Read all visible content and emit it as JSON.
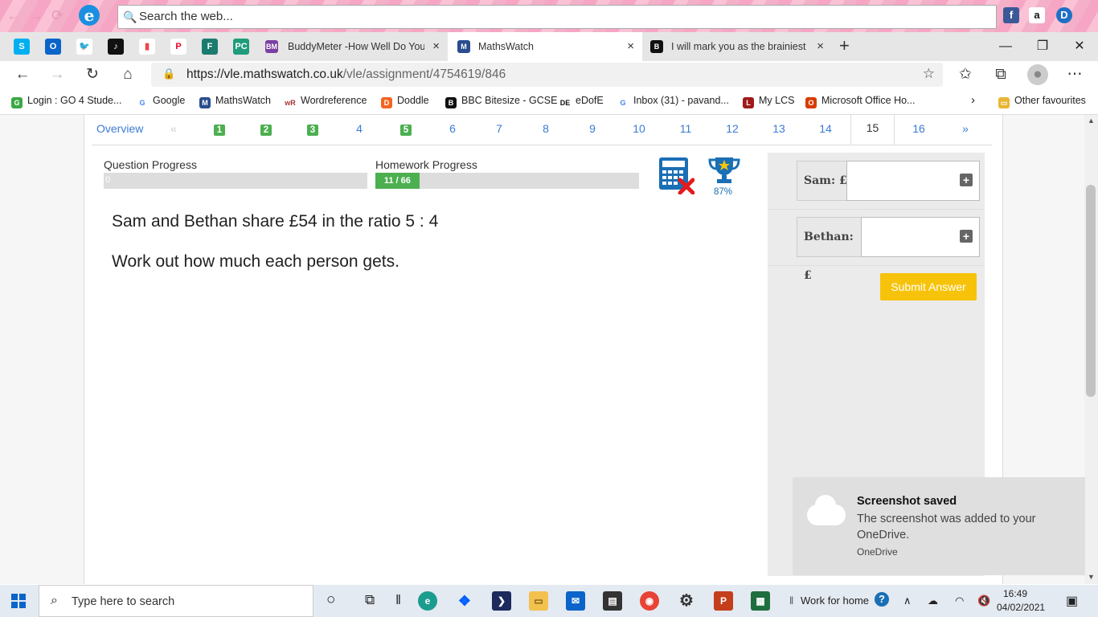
{
  "browser": {
    "search_placeholder": "Search the web...",
    "tabs": [
      {
        "title": "BuddyMeter -How Well Do You K",
        "close": "×"
      },
      {
        "title": "MathsWatch",
        "close": "×"
      },
      {
        "title": "I will mark you as the brainiest if",
        "close": "×"
      }
    ],
    "new_tab": "+",
    "url_host": "https://vle.mathswatch.co.uk",
    "url_path": "/vle/assignment/4754619/846",
    "favourites": [
      "Login : GO 4 Stude...",
      "Google",
      "MathsWatch",
      "Wordreference",
      "Doddle",
      "BBC Bitesize - GCSE",
      "eDofE",
      "Inbox (31) - pavand...",
      "My LCS",
      "Microsoft Office Ho..."
    ],
    "other_favourites": "Other favourites"
  },
  "question_nav": {
    "overview": "Overview",
    "prev": "«",
    "next": "»",
    "items": [
      "1",
      "2",
      "3",
      "4",
      "5",
      "6",
      "7",
      "8",
      "9",
      "10",
      "11",
      "12",
      "13",
      "14",
      "15",
      "16"
    ],
    "completed": [
      "1",
      "2",
      "3",
      "5"
    ],
    "current": "15"
  },
  "progress": {
    "question_label": "Question Progress",
    "question_value": "0",
    "homework_label": "Homework Progress",
    "homework_value": "11 / 66",
    "homework_fraction": 0.167,
    "trophy_percent": "87%"
  },
  "question": {
    "line1": "Sam and Bethan share £54 in the ratio 5 : 4",
    "line2": "Work out how much each person gets."
  },
  "answers": [
    {
      "label": "Sam: £",
      "value": ""
    },
    {
      "label": "Bethan: £",
      "value": ""
    }
  ],
  "submit_label": "Submit Answer",
  "toast": {
    "title": "Screenshot saved",
    "body": "The screenshot was added to your OneDrive.",
    "source": "OneDrive"
  },
  "taskbar": {
    "search_placeholder": "Type here to search",
    "work_label": "Work for home",
    "time": "16:49",
    "date": "04/02/2021"
  }
}
